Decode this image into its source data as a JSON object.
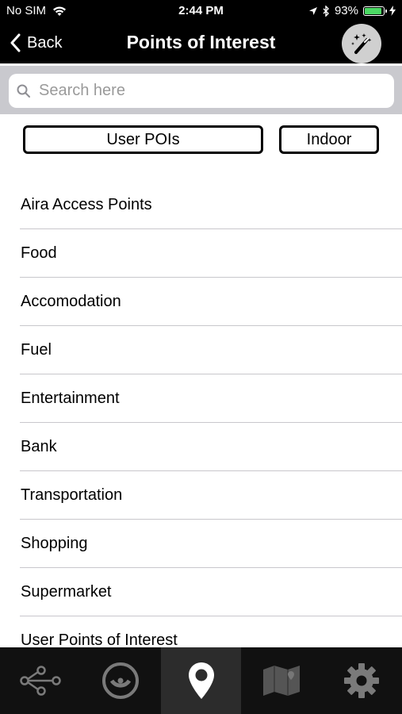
{
  "status_bar": {
    "carrier": "No SIM",
    "time": "2:44 PM",
    "battery": "93%",
    "battery_level": 0.93
  },
  "nav": {
    "back_label": "Back",
    "title": "Points of Interest",
    "magic_icon": "magic-wand-icon"
  },
  "search": {
    "placeholder": "Search here",
    "value": ""
  },
  "filters": {
    "user_pois": "User POIs",
    "indoor": "Indoor"
  },
  "poi_categories": [
    "Aira Access Points",
    "Food",
    "Accomodation",
    "Fuel",
    "Entertainment",
    "Bank",
    "Transportation",
    "Shopping",
    "Supermarket",
    "User Points of Interest"
  ],
  "tab_bar": {
    "tabs": [
      {
        "icon": "route-icon",
        "active": false
      },
      {
        "icon": "radar-icon",
        "active": false
      },
      {
        "icon": "location-pin-icon",
        "active": true
      },
      {
        "icon": "map-icon",
        "active": false
      },
      {
        "icon": "gear-icon",
        "active": false
      }
    ]
  },
  "colors": {
    "battery_green": "#4cd964",
    "bar_background": "#000000",
    "tab_bar_background": "#111111",
    "active_tab_background": "#2c2c2c",
    "search_area_background": "#c9c9ce"
  }
}
